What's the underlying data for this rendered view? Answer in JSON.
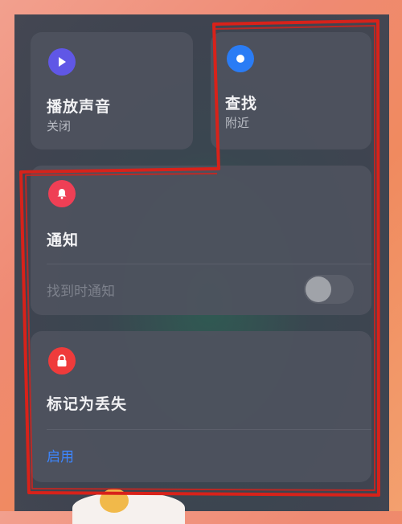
{
  "cards": {
    "play_sound": {
      "title": "播放声音",
      "status": "关闭",
      "icon": "play-icon",
      "icon_color": "#6057e6"
    },
    "find": {
      "title": "查找",
      "status": "附近",
      "icon": "dot-icon",
      "icon_color": "#2a7cf5"
    },
    "notify": {
      "title": "通知",
      "row_label": "找到时通知",
      "toggle_on": false,
      "icon": "bell-icon",
      "icon_color": "#ef3f55"
    },
    "lost": {
      "title": "标记为丢失",
      "action": "启用",
      "icon": "lock-icon",
      "icon_color": "#ef3b3b"
    }
  },
  "colors": {
    "accent": "#3d86ff",
    "annotation_red": "#d8221a"
  }
}
